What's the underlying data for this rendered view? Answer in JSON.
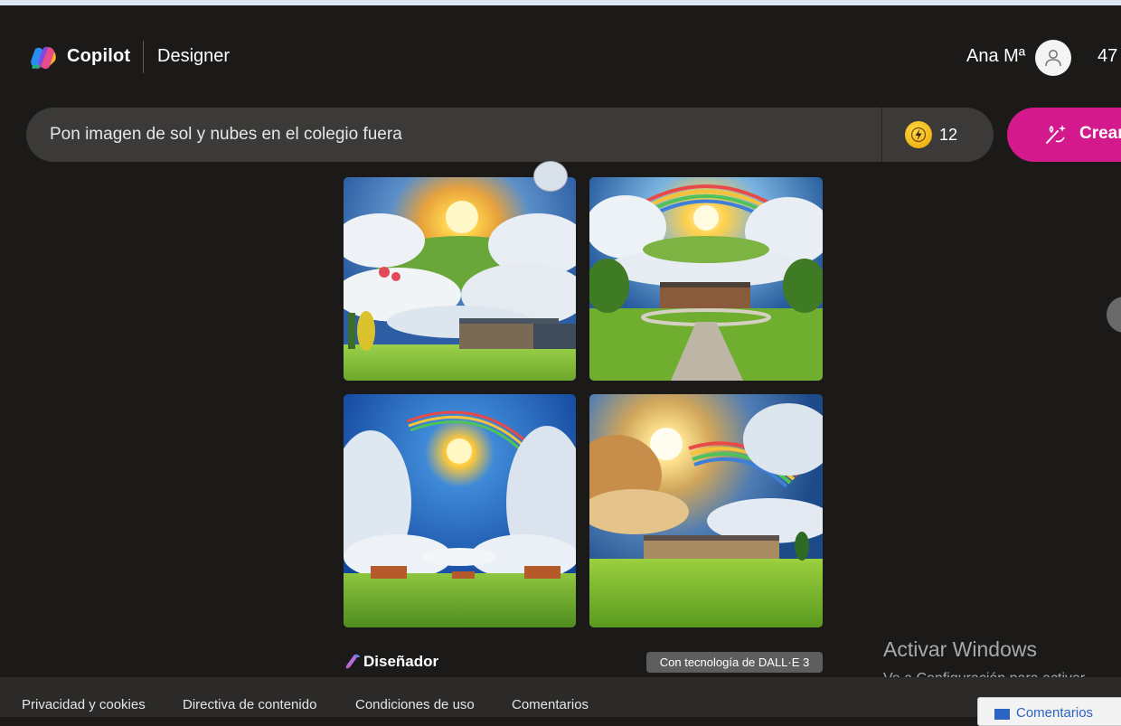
{
  "header": {
    "brand": "Copilot",
    "product": "Designer",
    "user_name": "Ana Mª",
    "count_partial": "47"
  },
  "prompt": {
    "value": "Pon imagen de sol y nubes en el colegio fuera",
    "boosts": "12",
    "create_label": "Crear"
  },
  "results": {
    "designer_label": "Diseñador",
    "powered_by": "Con tecnología de DALL·E 3"
  },
  "watermark": {
    "title": "Activar Windows",
    "subtitle": "Ve a Configuración para activar Windows."
  },
  "footer": {
    "links": [
      "Privacidad y cookies",
      "Directiva de contenido",
      "Condiciones de uso",
      "Comentarios"
    ],
    "feedback_label": "Comentarios"
  },
  "colors": {
    "background": "#1b1a19",
    "prompt_bar": "#3b3a39",
    "create_button": "#d4198c",
    "boost_coin": "#f2b705"
  },
  "icons": [
    "copilot-logo-icon",
    "user-avatar-icon",
    "boost-bolt-icon",
    "create-wand-icon",
    "designer-logo-icon",
    "feedback-icon"
  ]
}
